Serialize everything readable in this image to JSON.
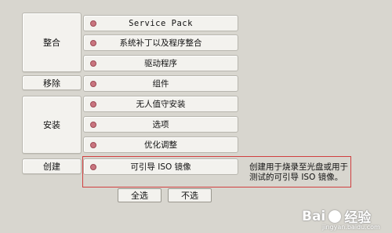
{
  "groups": {
    "integrate": "整合",
    "remove": "移除",
    "install": "安装",
    "create": "创建"
  },
  "tasks": {
    "service_pack": "Service Pack",
    "hotfixes": "系统补丁以及程序整合",
    "drivers": "驱动程序",
    "components": "组件",
    "unattended": "无人值守安装",
    "options": "选项",
    "tweaks": "优化调整",
    "bootable_iso": "可引导 ISO 镜像"
  },
  "description": "创建用于烧录至光盘或用于测试的可引导 ISO 镜像。",
  "buttons": {
    "select_all": "全选",
    "select_none": "不选"
  },
  "watermark": {
    "brand": "Bai",
    "brand2": "经验",
    "url": "jingyan.baidu.com"
  }
}
